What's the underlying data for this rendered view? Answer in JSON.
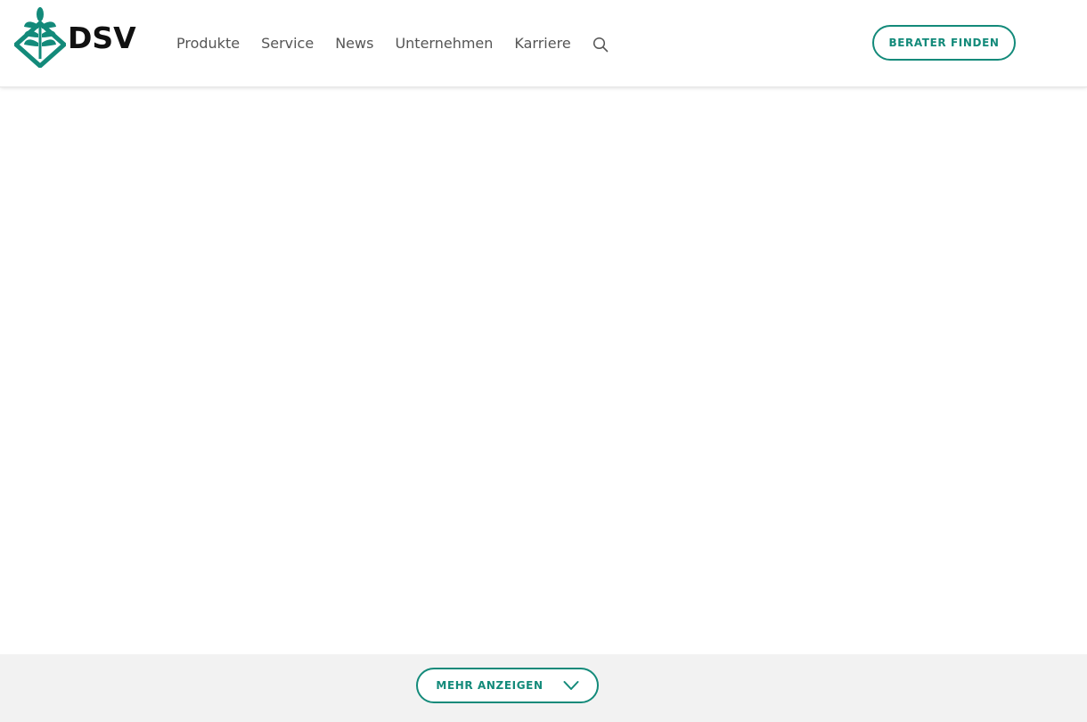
{
  "brand": {
    "name": "DSV",
    "accent_color": "#138a7a",
    "logo_icon": "wheat-diamond-icon"
  },
  "nav": {
    "items": [
      {
        "label": "Produkte"
      },
      {
        "label": "Service"
      },
      {
        "label": "News"
      },
      {
        "label": "Unternehmen"
      },
      {
        "label": "Karriere"
      }
    ],
    "search_icon": "search-icon"
  },
  "header": {
    "cta_label": "BERATER FINDEN"
  },
  "footer": {
    "more_label": "MEHR ANZEIGEN",
    "more_icon": "chevron-down-icon",
    "band_color": "#f2f2f2"
  }
}
